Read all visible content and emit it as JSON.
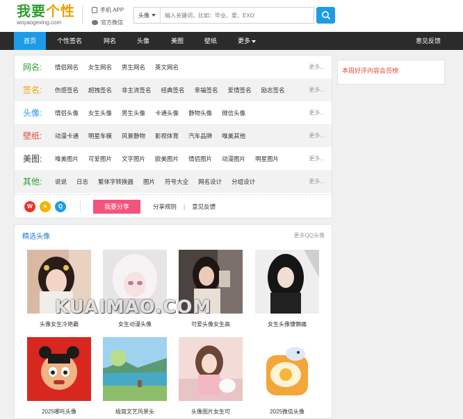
{
  "header": {
    "logo_main_green": "我要",
    "logo_main_orange": "个性",
    "logo_url": "woyaogexing.com",
    "mobile_app": "手机 APP",
    "wechat": "官方微信",
    "search_type": "头像",
    "search_placeholder": "输入关键词，比如：毕业、爱、EXO"
  },
  "nav": {
    "items": [
      "首页",
      "个性签名",
      "网名",
      "头像",
      "美图",
      "壁纸",
      "更多"
    ],
    "feedback": "意见反馈"
  },
  "categories": {
    "more": "更多...",
    "rows": [
      {
        "title": "网名:",
        "color": "#2f9e2f",
        "links": [
          "情侣网名",
          "女生网名",
          "男生网名",
          "英文网名"
        ]
      },
      {
        "title": "签名:",
        "color": "#f0a000",
        "links": [
          "伤感签名",
          "超拽签名",
          "非主流签名",
          "经典签名",
          "幸福签名",
          "爱情签名",
          "励志签名"
        ]
      },
      {
        "title": "头像:",
        "color": "#1e9be6",
        "links": [
          "情侣头像",
          "女生头像",
          "男生头像",
          "卡通头像",
          "静物头像",
          "微信头像"
        ]
      },
      {
        "title": "壁纸:",
        "color": "#e34a3b",
        "links": [
          "动漫卡通",
          "明星车模",
          "风景静物",
          "影视体育",
          "汽车品牌",
          "唯美其他"
        ]
      },
      {
        "title": "美图:",
        "color": "#333333",
        "links": [
          "唯美图片",
          "可爱图片",
          "文字图片",
          "欧美图片",
          "情侣图片",
          "动漫图片",
          "明星图片"
        ]
      },
      {
        "title": "其他:",
        "color": "#2f9e2f",
        "links": [
          "说说",
          "日志",
          "繁体字转换器",
          "图片",
          "符号大全",
          "网名设计",
          "分组设计"
        ]
      }
    ],
    "share_button": "我要分享",
    "share_rules": "分享规则",
    "separator": "|",
    "feedback": "意见反馈"
  },
  "sidebar": {
    "title": "本周好评内容会员榜"
  },
  "featured": {
    "title": "精选头像",
    "more": "更多QQ头像",
    "watermark": "KUAIMAO.COM",
    "cards": [
      "头像女生冷艳霸",
      "女生动漫头像",
      "可爱头像女生高",
      "女生头像慵懒痛",
      "2025哪吒头像",
      "极简文艺风景头",
      "头像图片女生可",
      "2025微信头像"
    ]
  }
}
